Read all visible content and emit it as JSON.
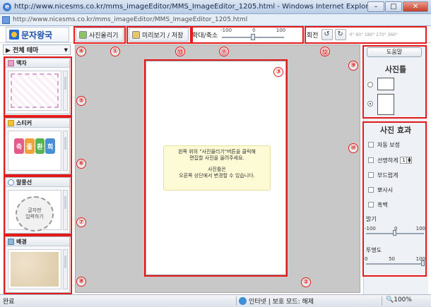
{
  "window": {
    "title": "http://www.nicesms.co.kr/mms_imageEditor/MMS_ImageEditor_1205.html - Windows Internet Explorer",
    "url": "http://www.nicesms.co.kr/mms_imageEditor/MMS_ImageEditor_1205.html",
    "min_label": "–",
    "max_label": "□",
    "close_label": "✕"
  },
  "app": {
    "logo_text": "문자왕국"
  },
  "toolbar": {
    "upload_label": "사진올리기",
    "preview_save_label": "미리보기 / 저장",
    "zoom_label": "확대/축소",
    "zoom_min": "-100",
    "zoom_mid": "0",
    "zoom_max": "100",
    "zoom_value": 0,
    "rotate_label": "회전",
    "rotate_ccw_glyph": "↺",
    "rotate_cw_glyph": "↻",
    "rotate_degrees": "0° 90° 180° 270° 360°"
  },
  "left": {
    "theme_select": "▶ 전체 테마",
    "theme_arrow": "▼",
    "frame_title": "액자",
    "sticker_title": "스티커",
    "sticker_chars": [
      "축",
      "졸",
      "환",
      "희"
    ],
    "bubble_title": "말풍선",
    "bubble_text_line1": "글자판",
    "bubble_text_line2": "입력하기",
    "background_title": "배경"
  },
  "canvas": {
    "hint_line1": "왼쪽 위의 \"사진올리기\"버튼을 클릭해",
    "hint_line2": "편집할 사진을 올려주세요.",
    "hint_line3": "사진틀은",
    "hint_line4": "오른쪽 상단에서 변경할 수 있습니다."
  },
  "right": {
    "help_label": "도움말",
    "photo_frame_title": "사진틀",
    "effects_title": "사진 효과",
    "auto_correct": "자동 보정",
    "sharpen": "선명하게",
    "sharpen_value": "1",
    "soften": "부드럽게",
    "sepia": "뽀사시",
    "grayscale": "흑백",
    "brightness_label": "밝기",
    "brightness_min": "-100",
    "brightness_mid": "0",
    "brightness_max": "100",
    "brightness_value": 0,
    "opacity_label": "투명도",
    "opacity_min": "0",
    "opacity_mid": "50",
    "opacity_max": "100",
    "opacity_value": 100
  },
  "annotations": [
    "①",
    "②",
    "③",
    "④",
    "⑤",
    "⑥",
    "⑦",
    "⑧",
    "⑨",
    "⑩",
    "⑪",
    "⑫",
    "⑬"
  ],
  "status": {
    "done": "완료",
    "zone": "인터넷 | 보호 모드: 해제",
    "zoom": "100%"
  },
  "colors": {
    "annotation": "#e51a1a",
    "canvas_bg": "#c8c8c8",
    "hint_bg": "#fdfbd5"
  }
}
